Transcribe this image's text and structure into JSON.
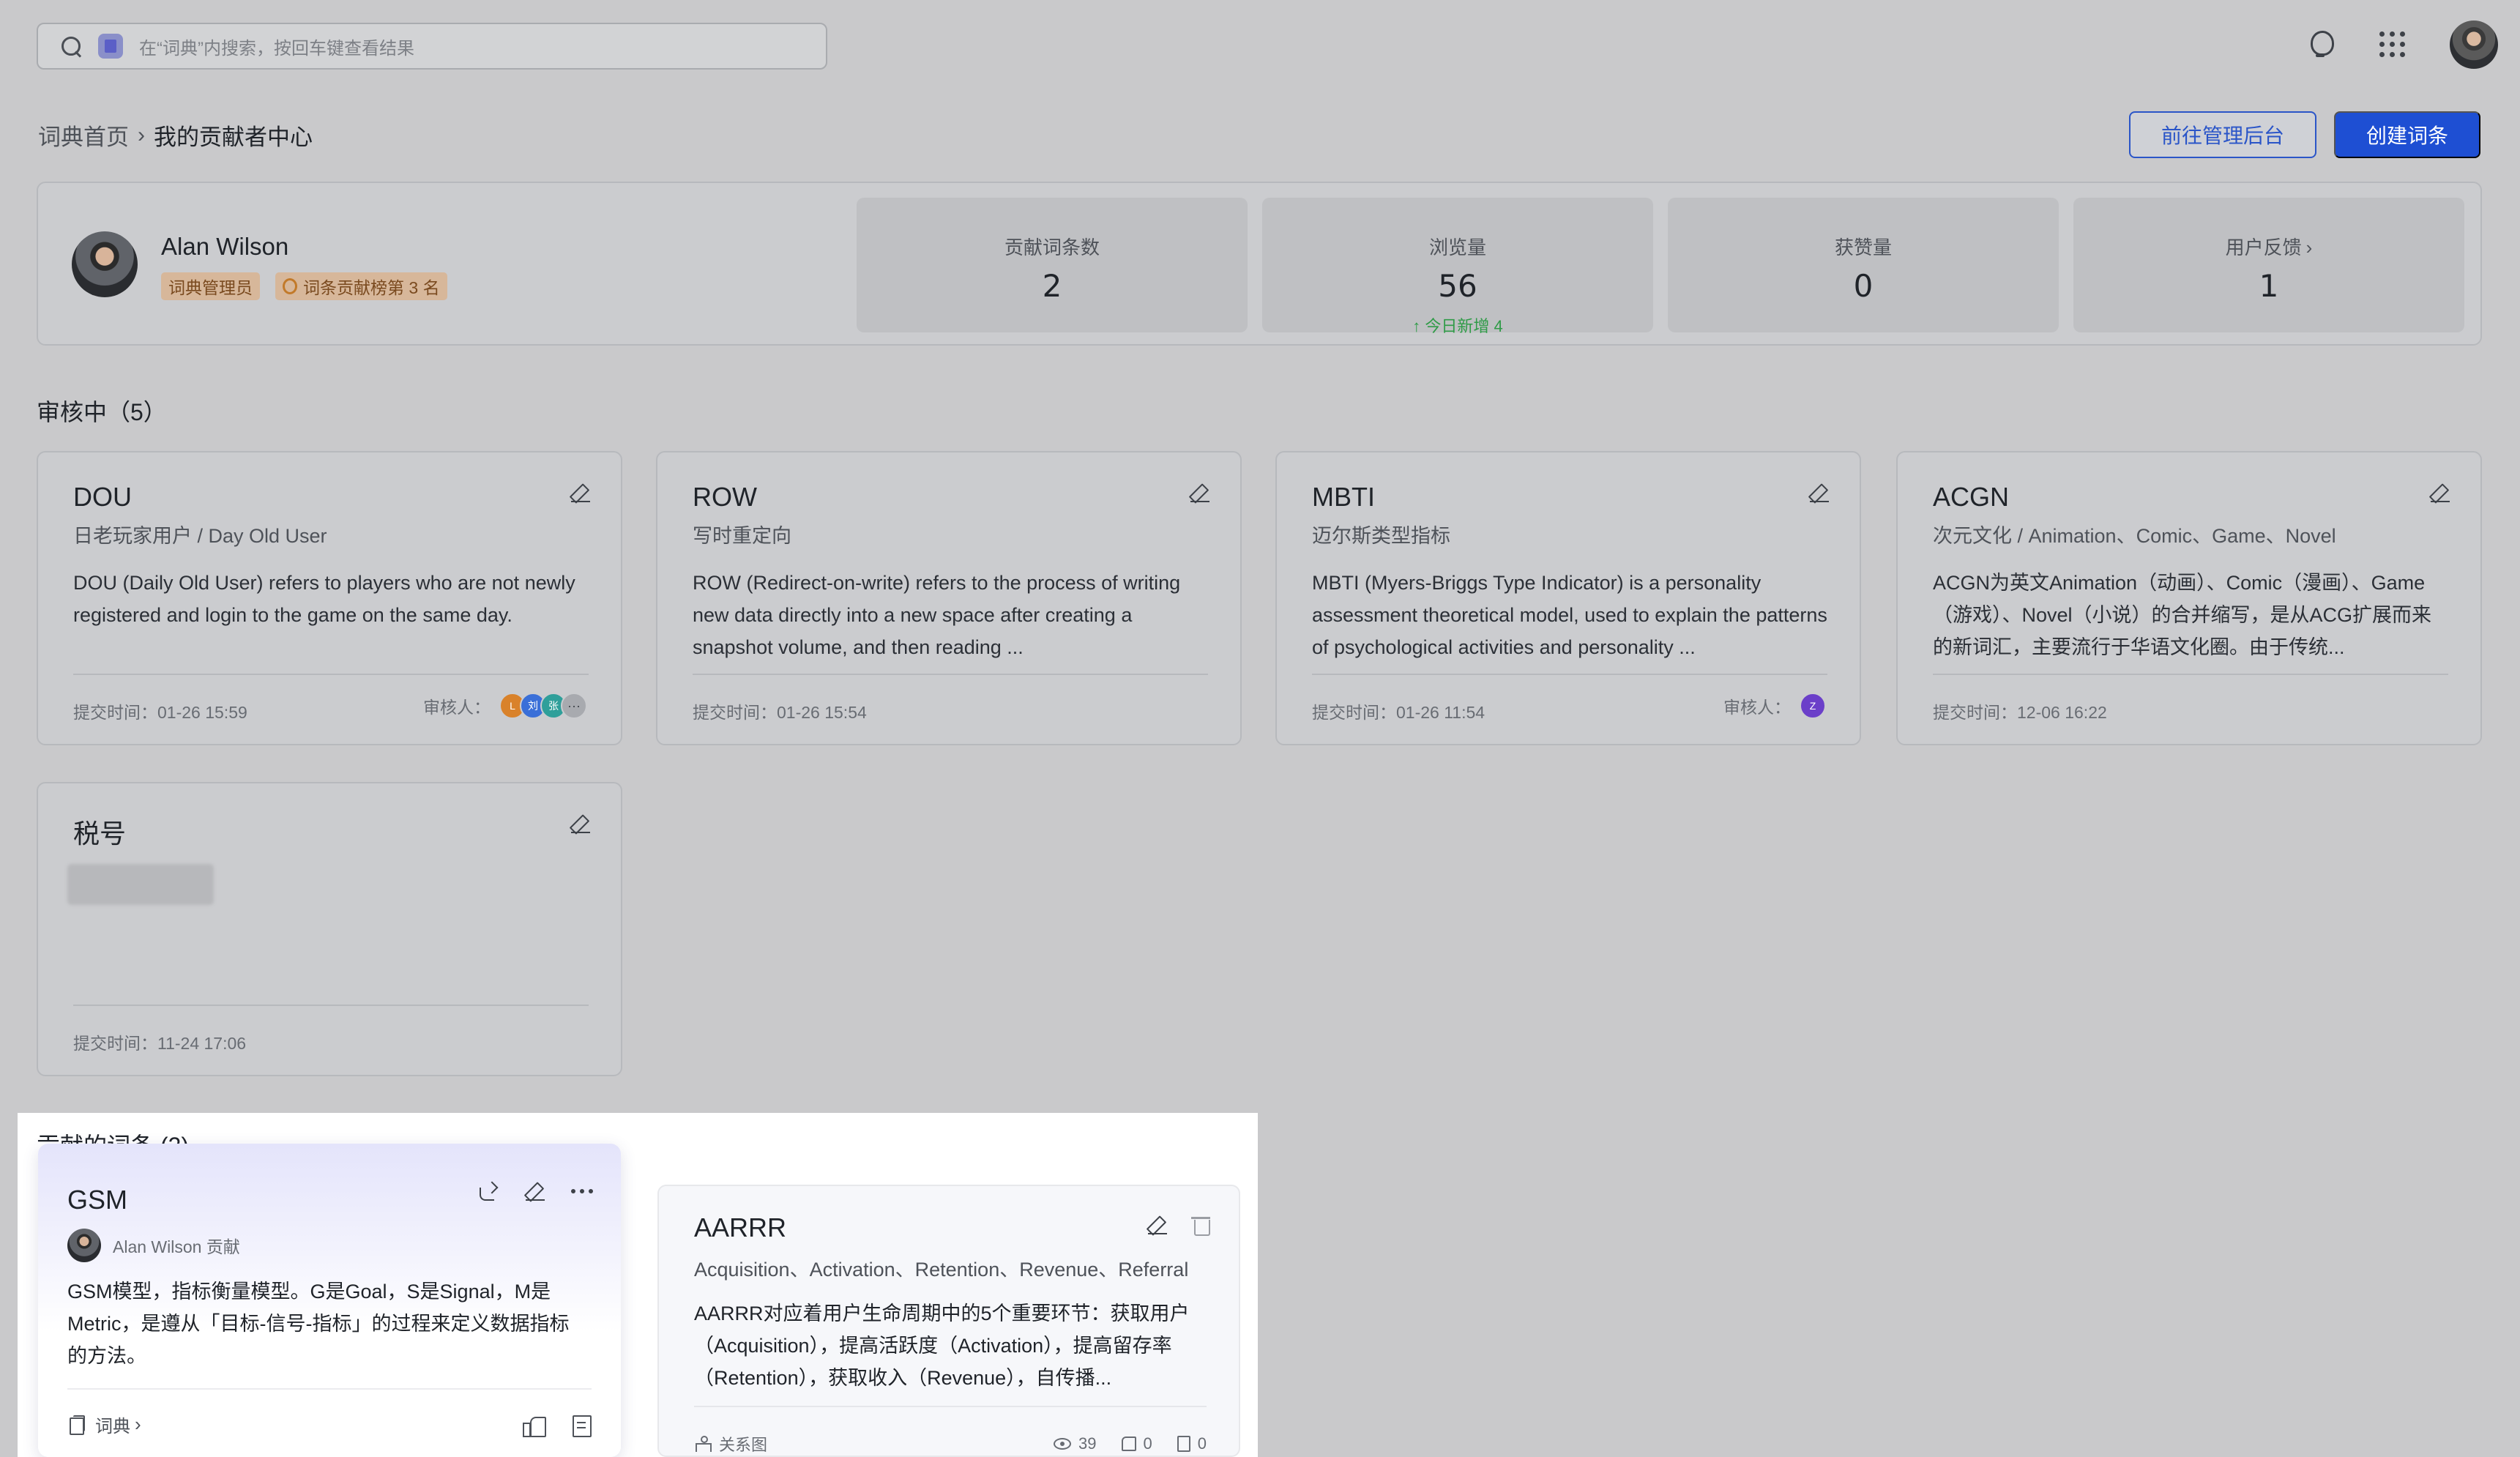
{
  "search": {
    "placeholder": "在“词典”内搜索，按回车键查看结果"
  },
  "breadcrumb": {
    "home": "词典首页",
    "separator": "›",
    "current": "我的贡献者中心"
  },
  "actions": {
    "admin_label": "前往管理后台",
    "create_label": "创建词条"
  },
  "profile": {
    "name": "Alan Wilson",
    "role_badge": "词典管理员",
    "rank_badge": "词条贡献榜第 3 名"
  },
  "stats": [
    {
      "label": "贡献词条数",
      "value": "2",
      "sub": ""
    },
    {
      "label": "浏览量",
      "value": "56",
      "sub": "↑ 今日新增 4"
    },
    {
      "label": "获赞量",
      "value": "0",
      "sub": ""
    },
    {
      "label": "用户反馈",
      "value": "1",
      "sub": "",
      "chevron": "›"
    }
  ],
  "review": {
    "title": "审核中（5）",
    "reviewer_label": "审核人：",
    "cards": [
      {
        "title": "DOU",
        "subtitle": "日老玩家用户 / Day Old User",
        "desc": "DOU (Daily Old User) refers to players who are not newly registered and login to the game on the same day.",
        "time": "提交时间：01-26 15:59",
        "reviewers": [
          {
            "initial": "L",
            "color": "#d9822b"
          },
          {
            "initial": "刘",
            "color": "#3a6fd8"
          },
          {
            "initial": "张",
            "color": "#2f9f9a"
          }
        ],
        "more": "···"
      },
      {
        "title": "ROW",
        "subtitle": "写时重定向",
        "desc": "ROW (Redirect-on-write) refers to the process of writing new data directly into a new space after creating a snapshot volume, and then reading ...",
        "time": "提交时间：01-26 15:54"
      },
      {
        "title": "MBTI",
        "subtitle": "迈尔斯类型指标",
        "desc": "MBTI (Myers-Briggs Type Indicator) is a personality assessment theoretical model, used to explain the patterns of psychological activities and personality ...",
        "time": "提交时间：01-26 11:54",
        "reviewers": [
          {
            "initial": "Z",
            "color": "#6b3fc9"
          }
        ]
      },
      {
        "title": "ACGN",
        "subtitle": "次元文化 / Animation、Comic、Game、Novel",
        "desc": "ACGN为英文Animation（动画）、Comic（漫画）、Game（游戏）、Novel（小说）的合并缩写，是从ACG扩展而来的新词汇，主要流行于华语文化圈。由于传统...",
        "time": "提交时间：12-06 16:22"
      },
      {
        "title": "税号",
        "subtitle": "",
        "desc": "",
        "time": "提交时间：11-24 17:06"
      }
    ]
  },
  "contrib": {
    "title": "贡献的词条 (2)",
    "gsm": {
      "title": "GSM",
      "author": "Alan Wilson 贡献",
      "desc": "GSM模型，指标衡量模型。G是Goal，S是Signal，M是Metric，是遵从「目标-信号-指标」的过程来定义数据指标的方法。",
      "category": "词典",
      "category_chevron": "›"
    },
    "aarrr": {
      "title": "AARRR",
      "subtitle": "Acquisition、Activation、Retention、Revenue、Referral",
      "desc": "AARRR对应着用户生命周期中的5个重要环节：获取用户（Acquisition），提高活跃度（Activation），提高留存率（Retention），获取收入（Revenue），自传播...",
      "graph_label": "关系图",
      "views": "39",
      "likes": "0",
      "comments": "0"
    }
  },
  "colors": {
    "primary": "#1e4fd3",
    "badge_bg": "#d7b79a",
    "positive": "#2f9b47"
  }
}
